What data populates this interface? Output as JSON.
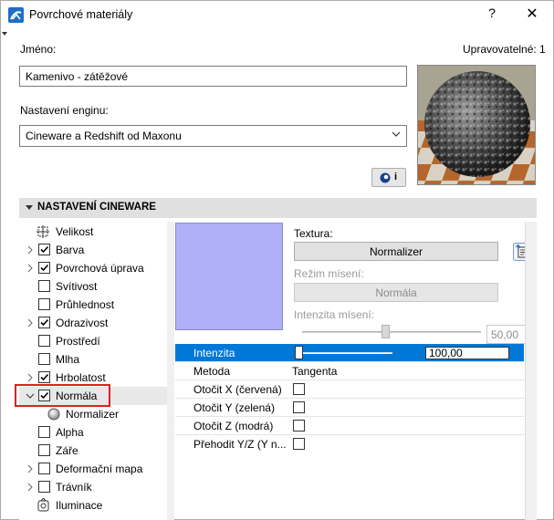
{
  "window": {
    "title": "Povrchové materiály",
    "help_label": "?",
    "close_label": "✕"
  },
  "form": {
    "name_label": "Jméno:",
    "editable_label": "Upravovatelné: 1",
    "name_value": "Kamenivo - zátěžové",
    "engine_label": "Nastavení enginu:",
    "engine_value": "Cineware a Redshift od Maxonu",
    "info_label": "i"
  },
  "section": {
    "title": "NASTAVENÍ CINEWARE"
  },
  "tree": {
    "items": [
      {
        "label": "Velikost",
        "icon": "size-icon",
        "checkbox": null,
        "expand": false
      },
      {
        "label": "Barva",
        "checkbox": true,
        "expand": true
      },
      {
        "label": "Povrchová úprava",
        "checkbox": true,
        "expand": true
      },
      {
        "label": "Svítivost",
        "checkbox": false,
        "expand": false
      },
      {
        "label": "Průhlednost",
        "checkbox": false,
        "expand": false
      },
      {
        "label": "Odrazivost",
        "checkbox": true,
        "expand": true
      },
      {
        "label": "Prostředí",
        "checkbox": false,
        "expand": false
      },
      {
        "label": "Mlha",
        "checkbox": false,
        "expand": false
      },
      {
        "label": "Hrbolatost",
        "checkbox": true,
        "expand": true
      },
      {
        "label": "Normála",
        "checkbox": true,
        "expand": "open",
        "selected": true
      },
      {
        "label": "Normalizer",
        "icon": "sphere-icon",
        "child": true
      },
      {
        "label": "Alpha",
        "checkbox": false,
        "expand": false
      },
      {
        "label": "Záře",
        "checkbox": false,
        "expand": false
      },
      {
        "label": "Deformační mapa",
        "checkbox": false,
        "expand": true
      },
      {
        "label": "Trávník",
        "checkbox": false,
        "expand": true
      },
      {
        "label": "Iluminace",
        "icon": "illumination-icon",
        "checkbox": null,
        "expand": false
      }
    ]
  },
  "texture": {
    "label": "Textura:",
    "button": "Normalizer",
    "blend_mode_label": "Režim mísení:",
    "blend_mode_value": "Normála",
    "blend_intensity_label": "Intenzita mísení:",
    "blend_intensity_value": "50,00",
    "swatch_color": "#b0b0f8"
  },
  "properties": {
    "intensity_label": "Intenzita",
    "intensity_value": "100,00",
    "method_label": "Metoda",
    "method_value": "Tangenta",
    "flip_x_label": "Otočit X (červená)",
    "flip_y_label": "Otočit Y (zelená)",
    "flip_z_label": "Otočit Z (modrá)",
    "swap_yz_label": "Přehodit Y/Z (Y n..."
  },
  "colors": {
    "accent": "#0078d7",
    "highlight_box": "#e0201c"
  }
}
